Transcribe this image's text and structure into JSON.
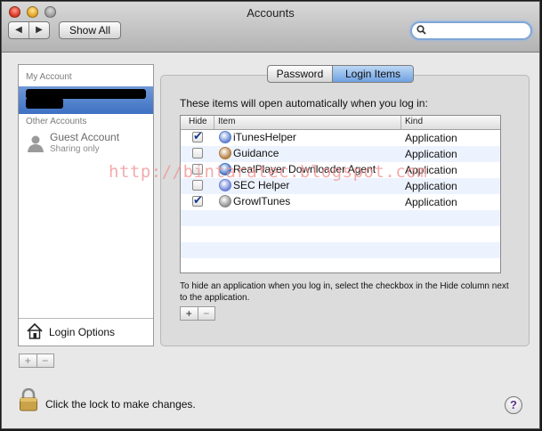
{
  "window": {
    "title": "Accounts"
  },
  "toolbar": {
    "back_icon": "◀",
    "forward_icon": "▶",
    "show_all_label": "Show All",
    "search_placeholder": ""
  },
  "sidebar": {
    "my_account_header": "My Account",
    "other_accounts_header": "Other Accounts",
    "guest": {
      "name": "Guest Account",
      "subtitle": "Sharing only"
    },
    "login_options_label": "Login Options",
    "add_label": "+",
    "remove_label": "−"
  },
  "tabs": [
    {
      "label": "Password"
    },
    {
      "label": "Login Items"
    }
  ],
  "login_items": {
    "intro": "These items will open automatically when you log in:",
    "columns": {
      "hide": "Hide",
      "item": "Item",
      "kind": "Kind"
    },
    "rows": [
      {
        "hide": true,
        "name": "iTunesHelper",
        "kind": "Application",
        "icon": "itunes-icon",
        "color": "#5a7fd0"
      },
      {
        "hide": false,
        "name": "Guidance",
        "kind": "Application",
        "icon": "house-icon",
        "color": "#b07a3c"
      },
      {
        "hide": false,
        "name": "RealPlayer Downloader Agent",
        "kind": "Application",
        "icon": "download-icon",
        "color": "#3a6ec2"
      },
      {
        "hide": false,
        "name": "SEC Helper",
        "kind": "Application",
        "icon": "globe-icon",
        "color": "#6a7fd6"
      },
      {
        "hide": true,
        "name": "GrowlTunes",
        "kind": "Application",
        "icon": "growl-icon",
        "color": "#8a8a8a"
      }
    ],
    "help_text": "To hide an application when you log in, select the checkbox in the Hide column next to the application.",
    "add_label": "+",
    "remove_label": "−"
  },
  "watermark": "http://bintaratec.blogspot.com",
  "footer": {
    "lock_text": "Click the lock to make changes.",
    "help_label": "?"
  },
  "colors": {
    "selection": "#3e71c3",
    "tab_selected": "#6fa1e2",
    "row_alt": "#edf3fe"
  }
}
